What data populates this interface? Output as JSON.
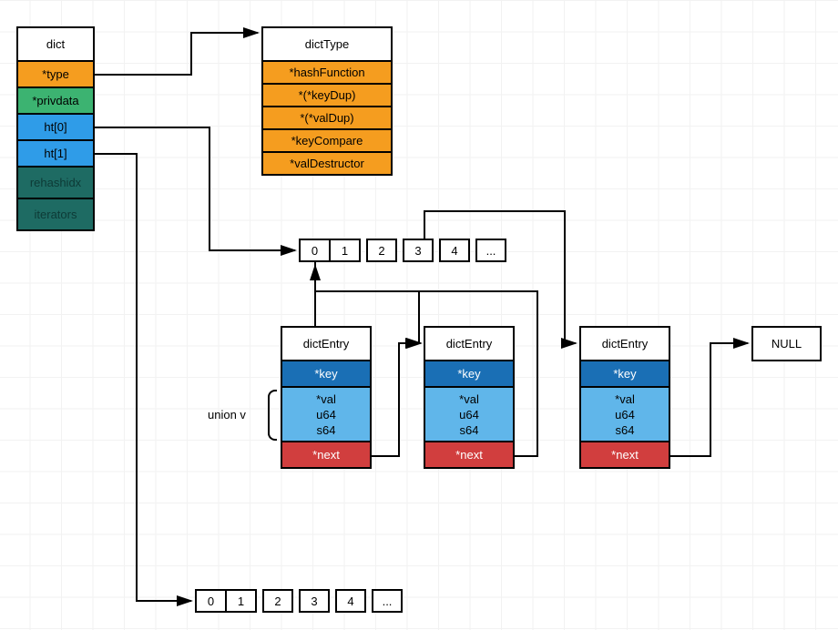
{
  "dict": {
    "title": "dict",
    "rows": [
      "*type",
      "*privdata",
      "ht[0]",
      "ht[1]",
      "rehashidx",
      "iterators"
    ]
  },
  "dictType": {
    "title": "dictType",
    "rows": [
      "*hashFunction",
      "*(*keyDup)",
      "*(*valDup)",
      "*keyCompare",
      "*valDestructor"
    ]
  },
  "hashRow1": [
    "0",
    "1",
    "2",
    "3",
    "4",
    "..."
  ],
  "hashRow2": [
    "0",
    "1",
    "2",
    "3",
    "4",
    "..."
  ],
  "unionLabel": "union v",
  "nullLabel": "NULL",
  "dictEntry": {
    "title": "dictEntry",
    "key": "*key",
    "val": [
      "*val",
      "u64",
      "s64"
    ],
    "next": "*next"
  }
}
